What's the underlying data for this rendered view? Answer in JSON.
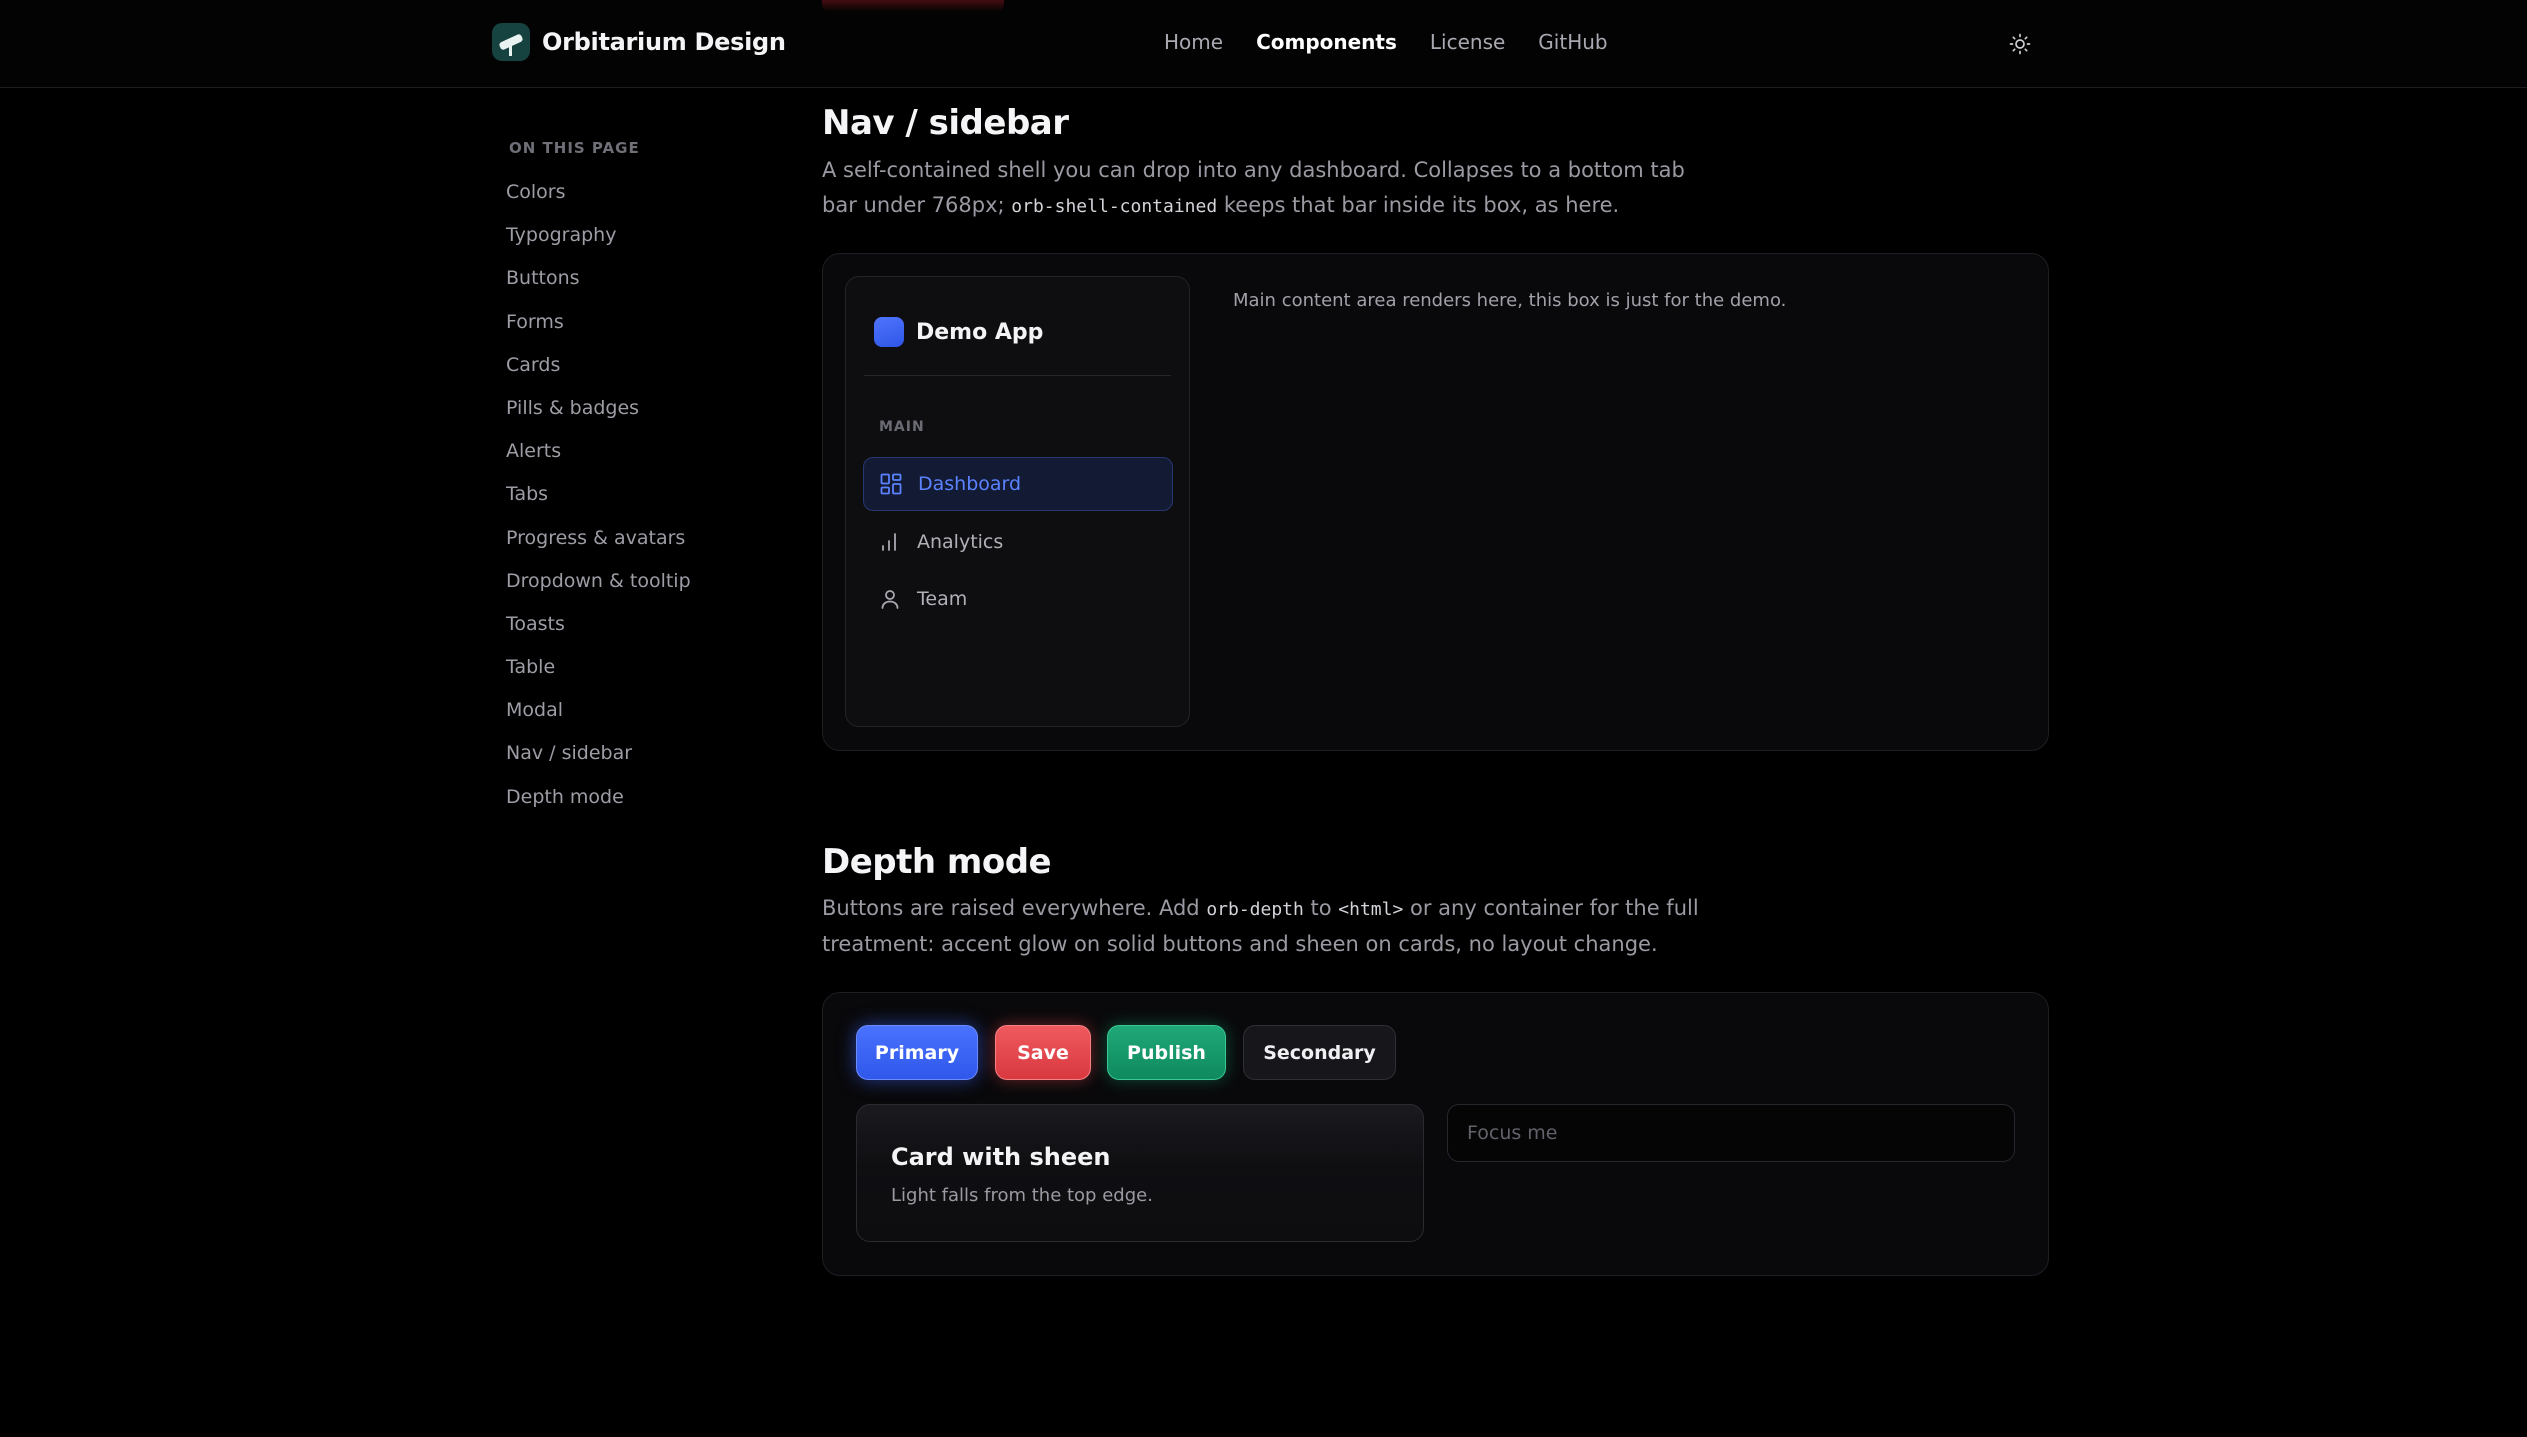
{
  "header": {
    "brand": "Orbitarium Design",
    "nav": [
      {
        "label": "Home",
        "active": false
      },
      {
        "label": "Components",
        "active": true
      },
      {
        "label": "License",
        "active": false
      },
      {
        "label": "GitHub",
        "active": false
      }
    ],
    "theme_icon": "sun-icon"
  },
  "toc": {
    "title": "ON THIS PAGE",
    "items": [
      "Colors",
      "Typography",
      "Buttons",
      "Forms",
      "Cards",
      "Pills & badges",
      "Alerts",
      "Tabs",
      "Progress & avatars",
      "Dropdown & tooltip",
      "Toasts",
      "Table",
      "Modal",
      "Nav / sidebar",
      "Depth mode"
    ]
  },
  "nav_section": {
    "title": "Nav / sidebar",
    "lead_part1": "A self-contained shell you can drop into any dashboard. Collapses to a bottom tab bar under 768px; ",
    "lead_code": "orb-shell-contained",
    "lead_part2": " keeps that bar inside its box, as here.",
    "demo": {
      "app_name": "Demo App",
      "section_label": "MAIN",
      "items": [
        {
          "label": "Dashboard",
          "icon": "grid-icon",
          "active": true
        },
        {
          "label": "Analytics",
          "icon": "bar-chart-icon",
          "active": false
        },
        {
          "label": "Team",
          "icon": "user-icon",
          "active": false
        }
      ],
      "main_note": "Main content area renders here, this box is just for the demo."
    }
  },
  "depth_section": {
    "title": "Depth mode",
    "lead_part1": "Buttons are raised everywhere. Add ",
    "lead_code1": "orb-depth",
    "lead_part2": " to ",
    "lead_code2": "<html>",
    "lead_part3": " or any container for the full treatment: accent glow on solid buttons and sheen on cards, no layout change.",
    "buttons": {
      "primary": "Primary",
      "save": "Save",
      "publish": "Publish",
      "secondary": "Secondary"
    },
    "card": {
      "title": "Card with sheen",
      "subtitle": "Light falls from the top edge."
    },
    "input_placeholder": "Focus me"
  },
  "colors": {
    "background": "#000000",
    "accent": "#3f66ff",
    "danger": "#e0474d",
    "success": "#139a6a"
  }
}
